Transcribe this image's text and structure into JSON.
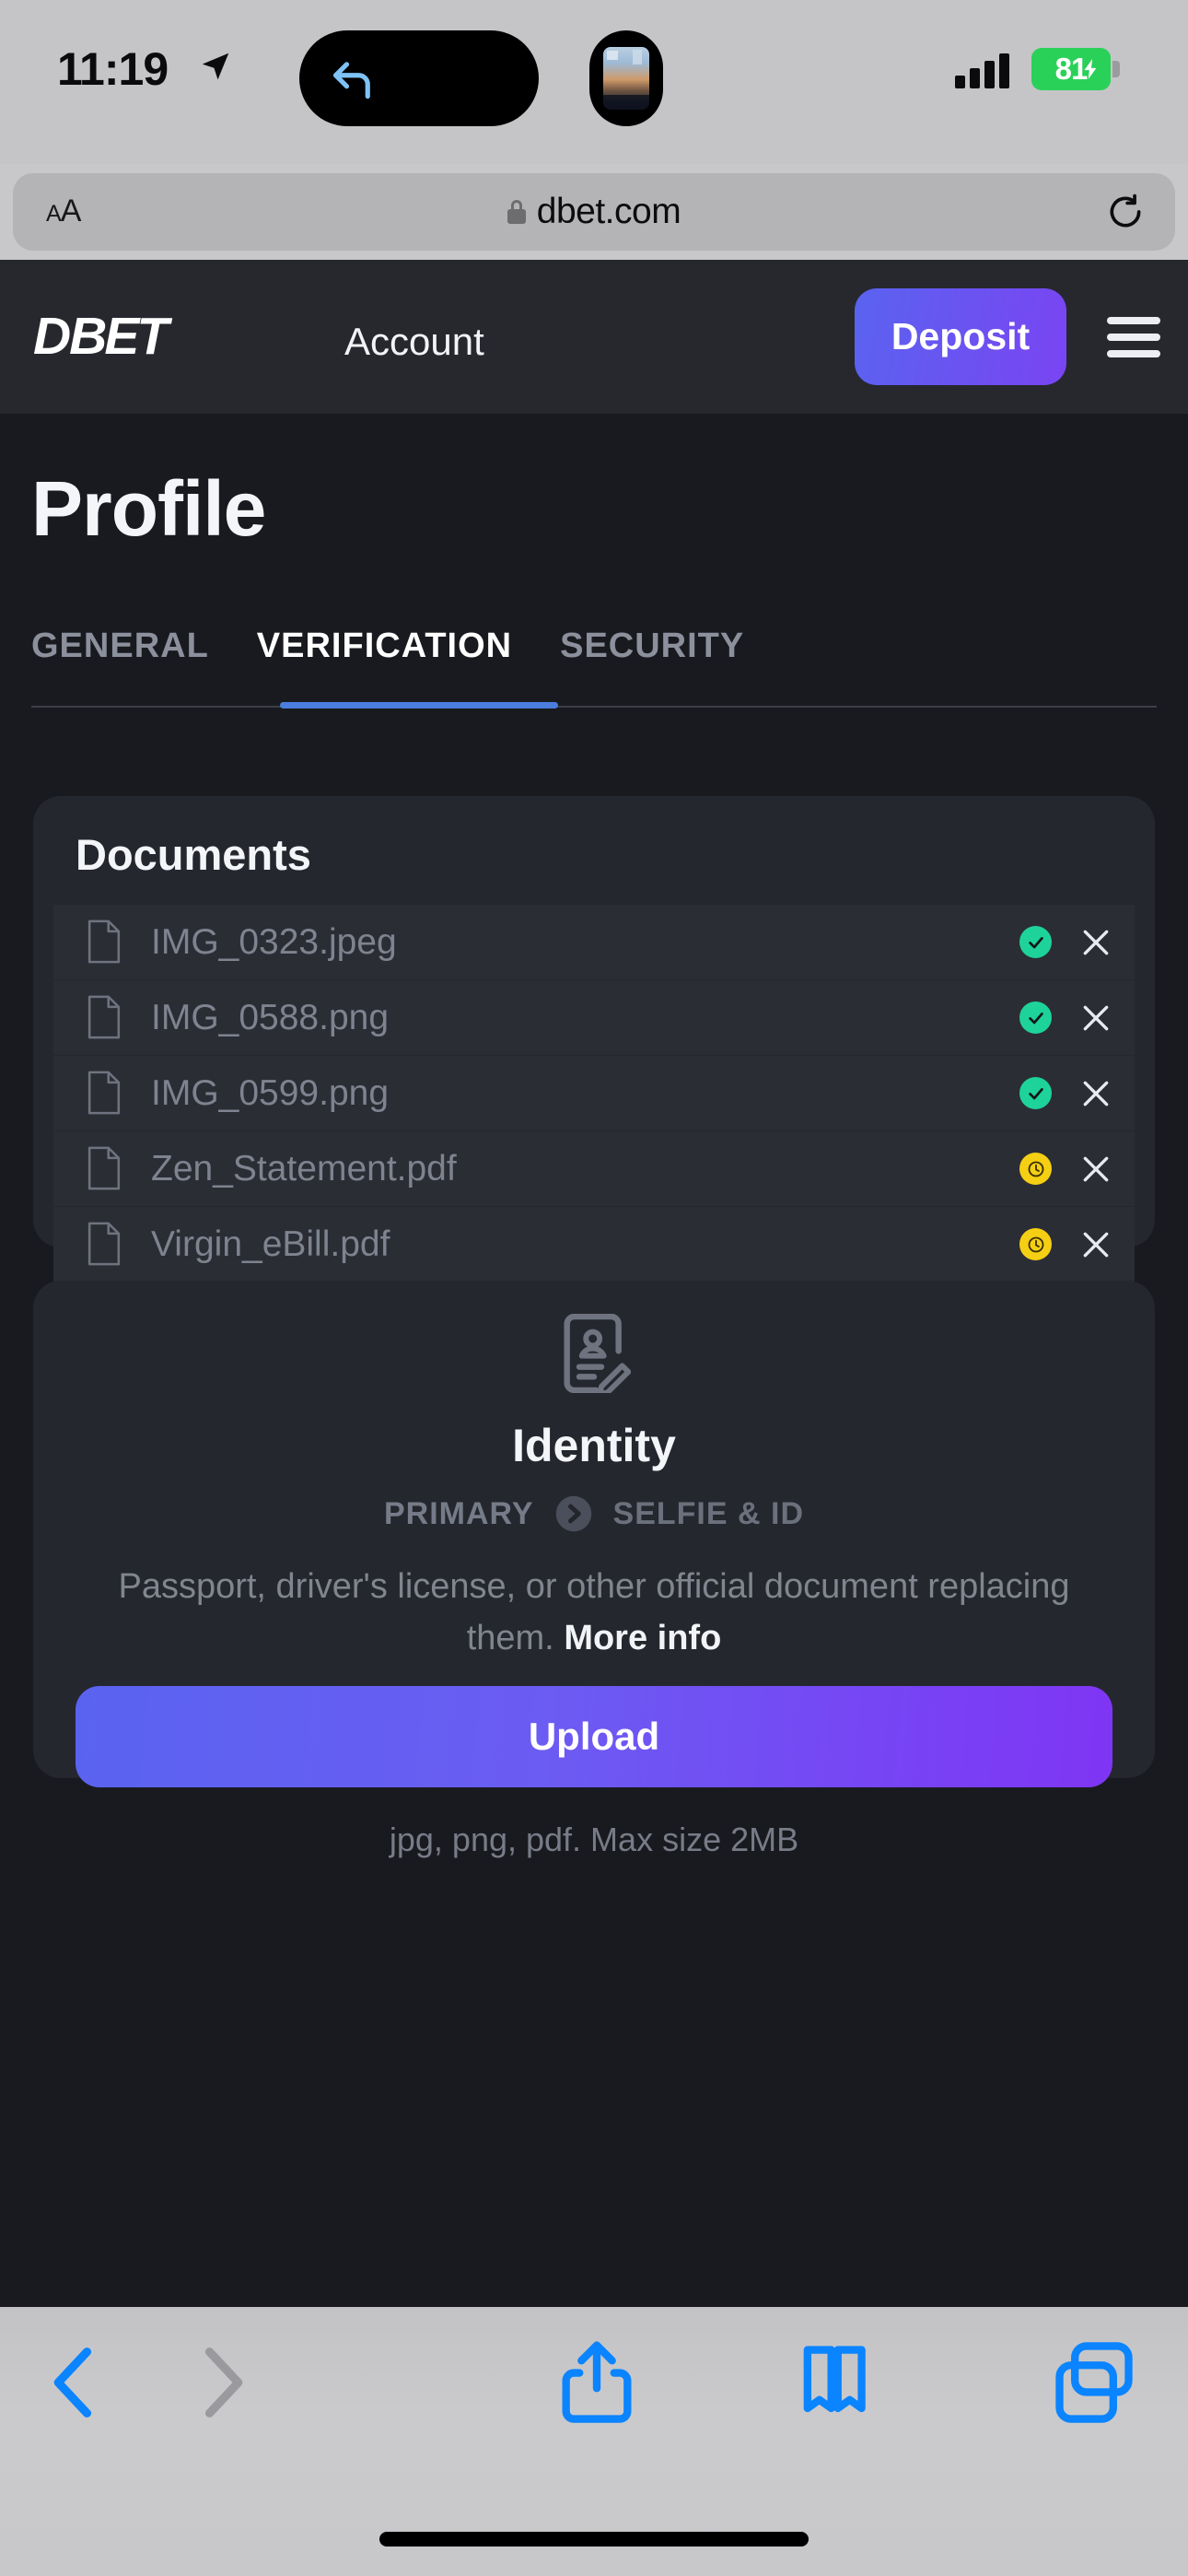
{
  "status_bar": {
    "time": "11:19",
    "battery_percent": "81",
    "location_icon": "location-arrow-icon",
    "signal_icon": "cellular-signal-icon",
    "battery_icon": "battery-charging-icon",
    "dynamic_island_back_icon": "back-arrow-icon",
    "dynamic_island_thumb": "photo-thumbnail"
  },
  "browser": {
    "text_size_label": "AA",
    "lock_icon": "lock-icon",
    "url": "dbet.com",
    "reload_icon": "reload-icon",
    "toolbar": {
      "back": "back-chevron-icon",
      "forward": "forward-chevron-icon",
      "share": "share-icon",
      "bookmarks": "bookmarks-icon",
      "tabs": "tabs-icon"
    }
  },
  "site_header": {
    "logo_d": "D",
    "logo_be": "BE",
    "logo_t": "T",
    "account_label": "Account",
    "deposit_label": "Deposit",
    "menu_icon": "hamburger-menu-icon"
  },
  "page": {
    "title": "Profile",
    "tabs": [
      {
        "label": "GENERAL",
        "active": false
      },
      {
        "label": "VERIFICATION",
        "active": true
      },
      {
        "label": "SECURITY",
        "active": false
      }
    ]
  },
  "documents_card": {
    "title": "Documents",
    "files": [
      {
        "name": "IMG_0323.jpeg",
        "status": "approved",
        "status_icon": "check-icon"
      },
      {
        "name": "IMG_0588.png",
        "status": "approved",
        "status_icon": "check-icon"
      },
      {
        "name": "IMG_0599.png",
        "status": "approved",
        "status_icon": "check-icon"
      },
      {
        "name": "Zen_Statement.pdf",
        "status": "pending",
        "status_icon": "clock-icon"
      },
      {
        "name": "Virgin_eBill.pdf",
        "status": "pending",
        "status_icon": "clock-icon"
      }
    ],
    "remove_icon": "close-x-icon",
    "file_icon": "document-file-icon"
  },
  "identity_card": {
    "icon": "id-card-icon",
    "title": "Identity",
    "step_primary": "PRIMARY",
    "step_arrow_icon": "chevron-right-circle-icon",
    "step_selfie": "SELFIE & ID",
    "description_text": "Passport, driver's license, or other official document replacing them.",
    "more_info_label": "More info",
    "upload_label": "Upload",
    "upload_hint": "jpg, png, pdf. Max size 2MB"
  },
  "colors": {
    "page_bg": "#191a1f",
    "header_bg": "#26282e",
    "card_bg": "#25272e",
    "row_bg": "#2b2d35",
    "accent_blue": "#5a63f0",
    "accent_purple": "#7f35f4",
    "tab_underline": "#4a7dde",
    "approved": "#1ed39a",
    "pending": "#f5cf14",
    "safari_chrome": "#c8c8ca",
    "safari_tint": "#0a84ff"
  }
}
